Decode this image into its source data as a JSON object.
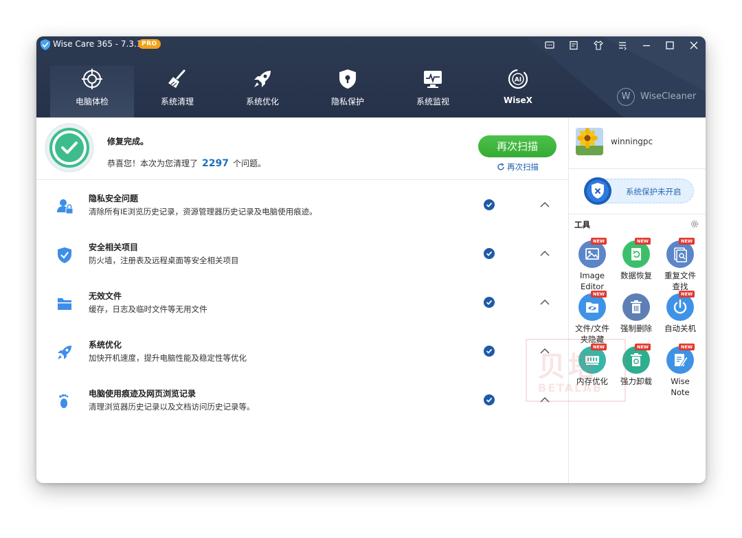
{
  "window": {
    "title": "Wise Care 365 - 7.3.1",
    "badge": "PRO"
  },
  "titlebar_buttons": [
    "feedback-icon",
    "notes-icon",
    "skin-icon",
    "menu-icon",
    "minimize-icon",
    "maximize-icon",
    "close-icon"
  ],
  "nav": {
    "tabs": [
      {
        "label": "电脑体检",
        "icon": "crosshair-icon",
        "active": true
      },
      {
        "label": "系统清理",
        "icon": "broom-icon",
        "active": false
      },
      {
        "label": "系统优化",
        "icon": "rocket-icon",
        "active": false
      },
      {
        "label": "隐私保护",
        "icon": "shield-lock-icon",
        "active": false
      },
      {
        "label": "系统监视",
        "icon": "monitor-icon",
        "active": false
      },
      {
        "label": "WiseX",
        "icon": "ai-icon",
        "active": false
      }
    ],
    "brand": {
      "logo_letter": "W",
      "text": "WiseCleaner"
    }
  },
  "status": {
    "title": "修复完成。",
    "desc_prefix": "恭喜您！本次为您清理了",
    "count": "2297",
    "desc_suffix": "个问题。",
    "rescan_button": "再次扫描",
    "rescan_link": "再次扫描"
  },
  "items": [
    {
      "title": "隐私安全问题",
      "desc": "清除所有IE浏览历史记录，资源管理器历史记录及电脑使用痕迹。",
      "icon": "user-lock-icon"
    },
    {
      "title": "安全相关项目",
      "desc": "防火墙，注册表及远程桌面等安全相关项目",
      "icon": "shield-check-icon"
    },
    {
      "title": "无效文件",
      "desc": "缓存，日志及临时文件等无用文件",
      "icon": "folder-icon"
    },
    {
      "title": "系统优化",
      "desc": "加快开机速度，提升电脑性能及稳定性等优化",
      "icon": "rocket-icon"
    },
    {
      "title": "电脑使用痕迹及网页浏览记录",
      "desc": "清理浏览器历史记录以及文档访问历史记录等。",
      "icon": "footprint-icon"
    }
  ],
  "sidebar": {
    "username": "winningpc",
    "protection_status": "系统保护未开启",
    "tools_header": "工具",
    "new_badge": "NEW",
    "tools": [
      {
        "label": "Image Editor",
        "icon": "image-icon",
        "color": "#5b86c8",
        "new": true
      },
      {
        "label": "数据恢复",
        "icon": "recovery-icon",
        "color": "#3cbf6b",
        "new": true
      },
      {
        "label": "重复文件查找",
        "icon": "duplicate-icon",
        "color": "#5b86c8",
        "new": true
      },
      {
        "label": "文件/文件夹隐藏",
        "icon": "eye-hide-icon",
        "color": "#3f93e6",
        "new": true
      },
      {
        "label": "强制删除",
        "icon": "trash-icon",
        "color": "#5d7fb5",
        "new": false
      },
      {
        "label": "自动关机",
        "icon": "power-icon",
        "color": "#3f93e6",
        "new": true
      },
      {
        "label": "内存优化",
        "icon": "memory-icon",
        "color": "#36b6a7",
        "new": true
      },
      {
        "label": "强力卸载",
        "icon": "uninstall-icon",
        "color": "#2fae8f",
        "new": true
      },
      {
        "label": "Wise Note",
        "icon": "note-icon",
        "color": "#3f93e6",
        "new": true
      }
    ]
  },
  "watermark": {
    "cn": "贝塔",
    "en": "BETALAB"
  }
}
